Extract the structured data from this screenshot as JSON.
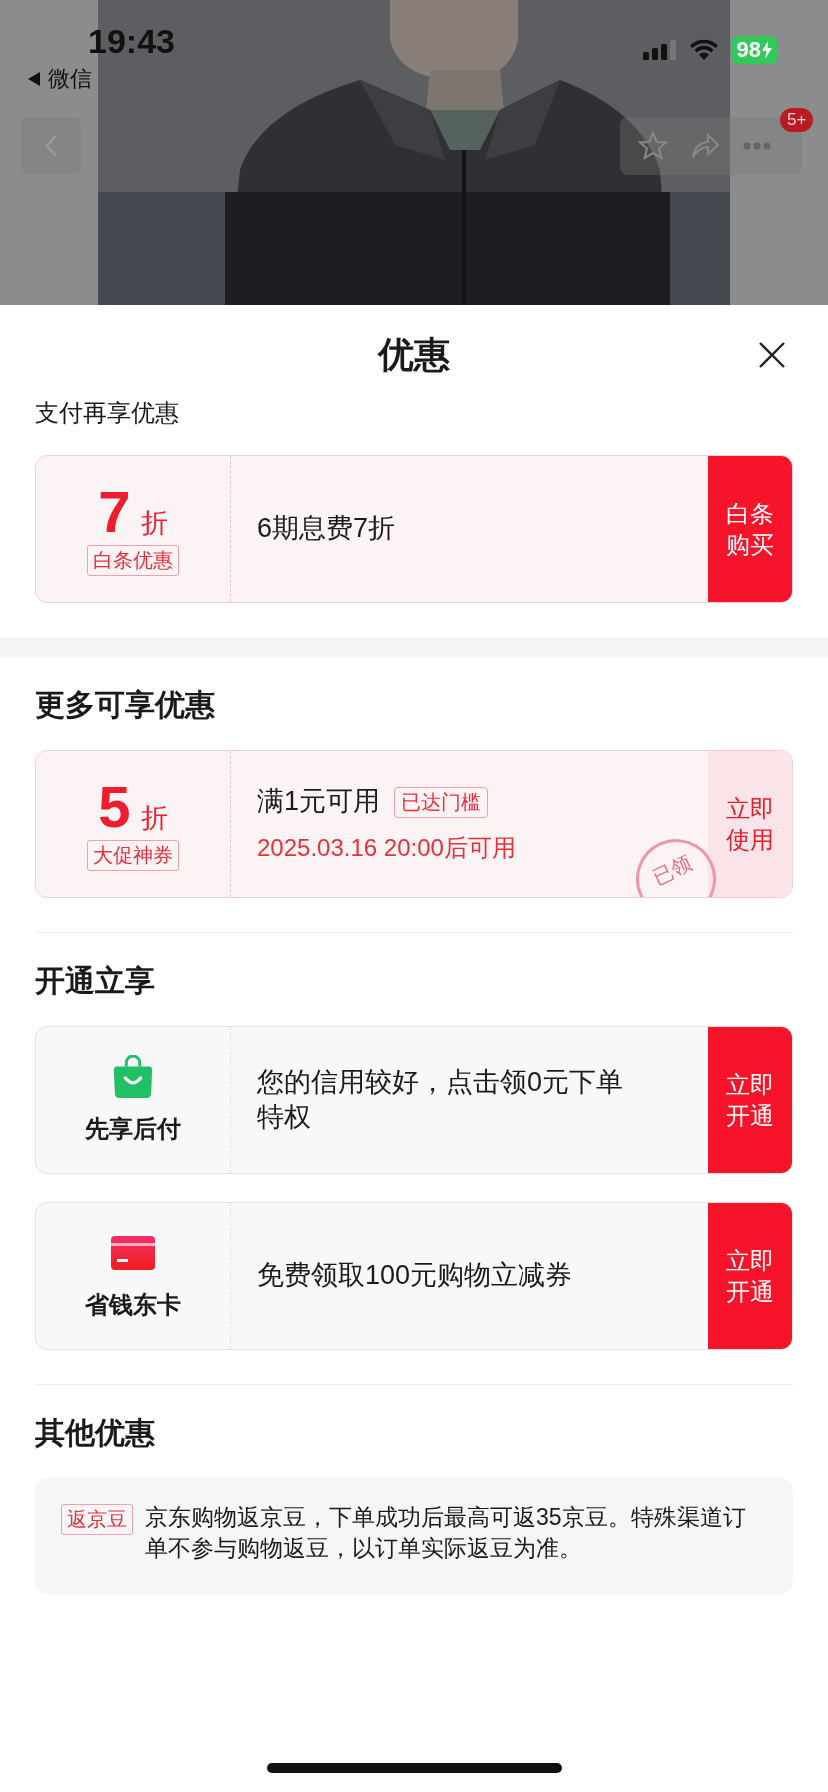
{
  "status_bar": {
    "time": "19:43",
    "back_app": "微信",
    "battery": "98"
  },
  "nav": {
    "badge": "5+"
  },
  "sheet": {
    "title": "优惠",
    "sections": [
      {
        "title": "支付再享优惠",
        "items": [
          {
            "kind": "discount",
            "value": "7",
            "unit": "折",
            "tag": "白条优惠",
            "text": "6期息费7折",
            "button": "白条购买",
            "emphasized": true
          }
        ]
      },
      {
        "title": "更多可享优惠",
        "items": [
          {
            "kind": "discount",
            "value": "5",
            "unit": "折",
            "tag": "大促神券",
            "text": "满1元可用",
            "badge": "已达门槛",
            "note": "2025.03.16 20:00后可用",
            "stamp": "已领",
            "button": "立即使用",
            "emphasized": false
          }
        ]
      },
      {
        "title": "开通立享",
        "items": [
          {
            "kind": "service",
            "name": "先享后付",
            "text": "您的信用较好，点击领0元下单特权",
            "button": "立即开通",
            "emphasized": true
          },
          {
            "kind": "service",
            "name": "省钱东卡",
            "text": "免费领取100元购物立减券",
            "button": "立即开通",
            "emphasized": true
          }
        ]
      },
      {
        "title": "其他优惠",
        "items": [
          {
            "kind": "info",
            "tag": "返京豆",
            "text": "京东购物返京豆，下单成功后最高可返35京豆。特殊渠道订单不参与购物返豆，以订单实际返豆为准。"
          }
        ]
      }
    ]
  }
}
